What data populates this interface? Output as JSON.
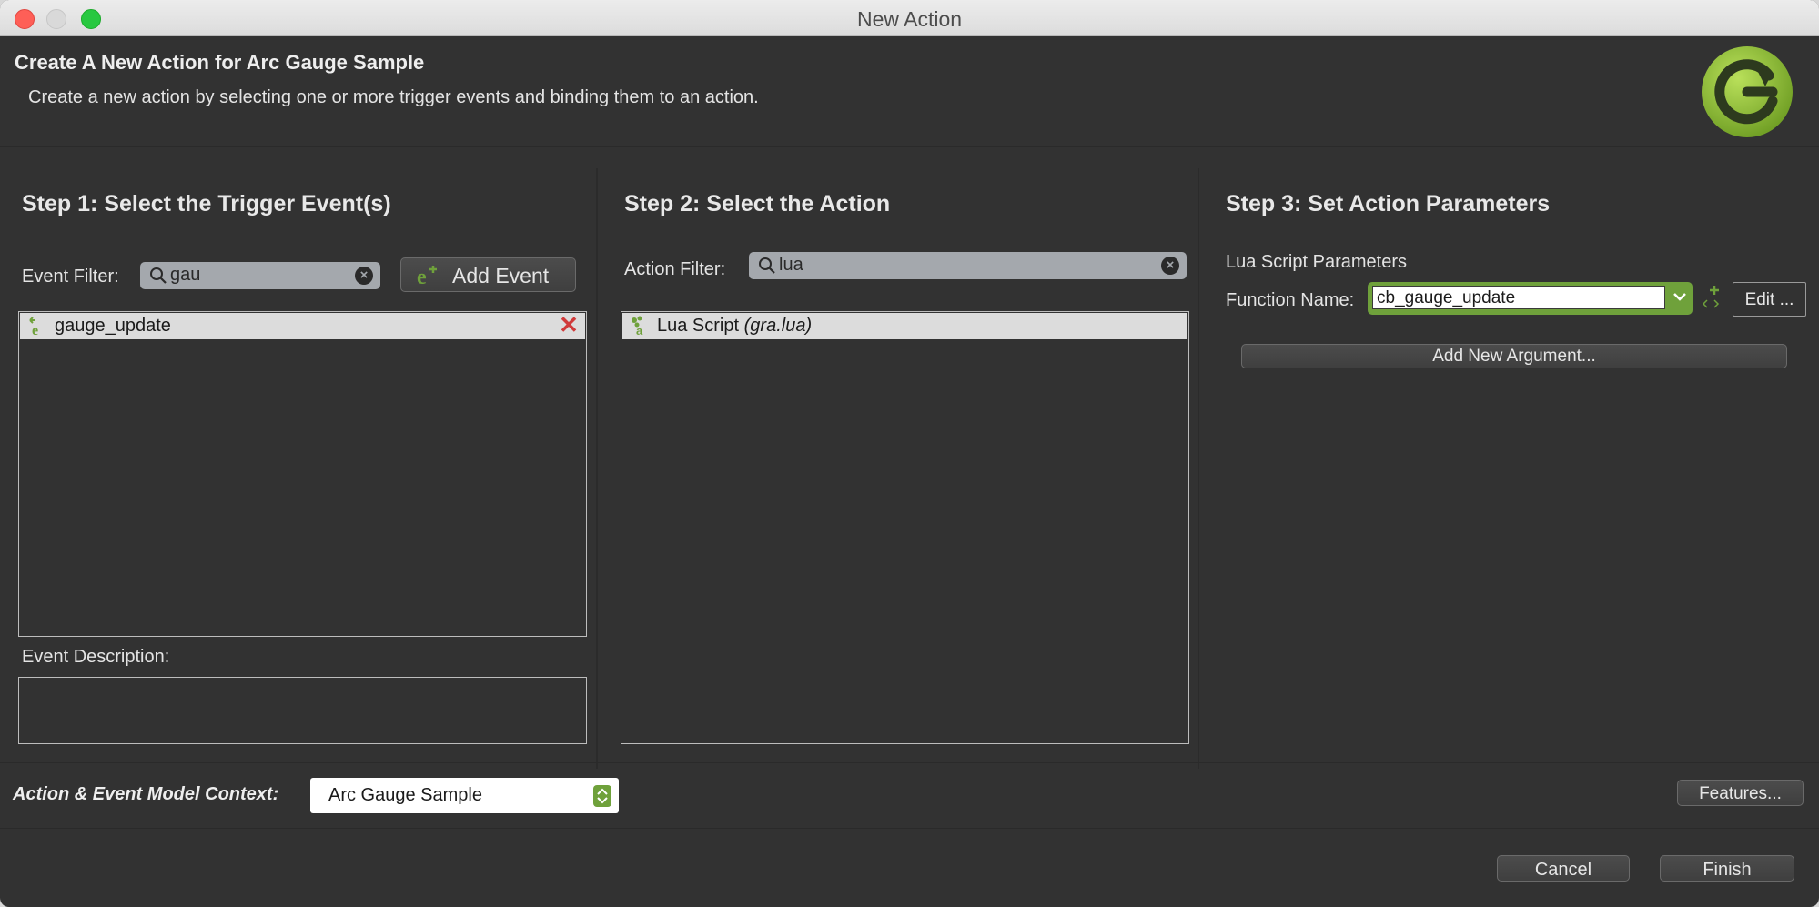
{
  "window": {
    "title": "New Action"
  },
  "header": {
    "title": "Create A New Action for Arc Gauge Sample",
    "description": "Create a new action by selecting one or more trigger events and binding them to an action."
  },
  "step1": {
    "title": "Step 1: Select the Trigger Event(s)",
    "filter_label": "Event Filter:",
    "filter_value": "gau",
    "add_event_label": "Add Event",
    "events": [
      "gauge_update"
    ],
    "description_label": "Event Description:",
    "description_value": ""
  },
  "step2": {
    "title": "Step 2: Select the Action",
    "filter_label": "Action Filter:",
    "filter_value": "lua",
    "actions": [
      {
        "name": "Lua Script",
        "detail": "(gra.lua)"
      }
    ]
  },
  "step3": {
    "title": "Step 3: Set Action Parameters",
    "section_label": "Lua Script Parameters",
    "function_label": "Function Name:",
    "function_value": "cb_gauge_update",
    "edit_label": "Edit ...",
    "add_argument_label": "Add New Argument..."
  },
  "footer": {
    "context_label": "Action & Event Model Context:",
    "context_value": "Arc Gauge Sample",
    "features_label": "Features...",
    "cancel_label": "Cancel",
    "finish_label": "Finish"
  },
  "colors": {
    "background": "#323232",
    "accent_green": "#6fa13b",
    "delete_red": "#d03a3a",
    "search_field": "#a4a8ad"
  },
  "icons": [
    "search-icon",
    "clear-icon",
    "add-event-icon",
    "event-icon",
    "delete-icon",
    "lua-script-icon",
    "add-argument-icon",
    "chevron-down-icon",
    "stepper-icon",
    "app-logo"
  ]
}
